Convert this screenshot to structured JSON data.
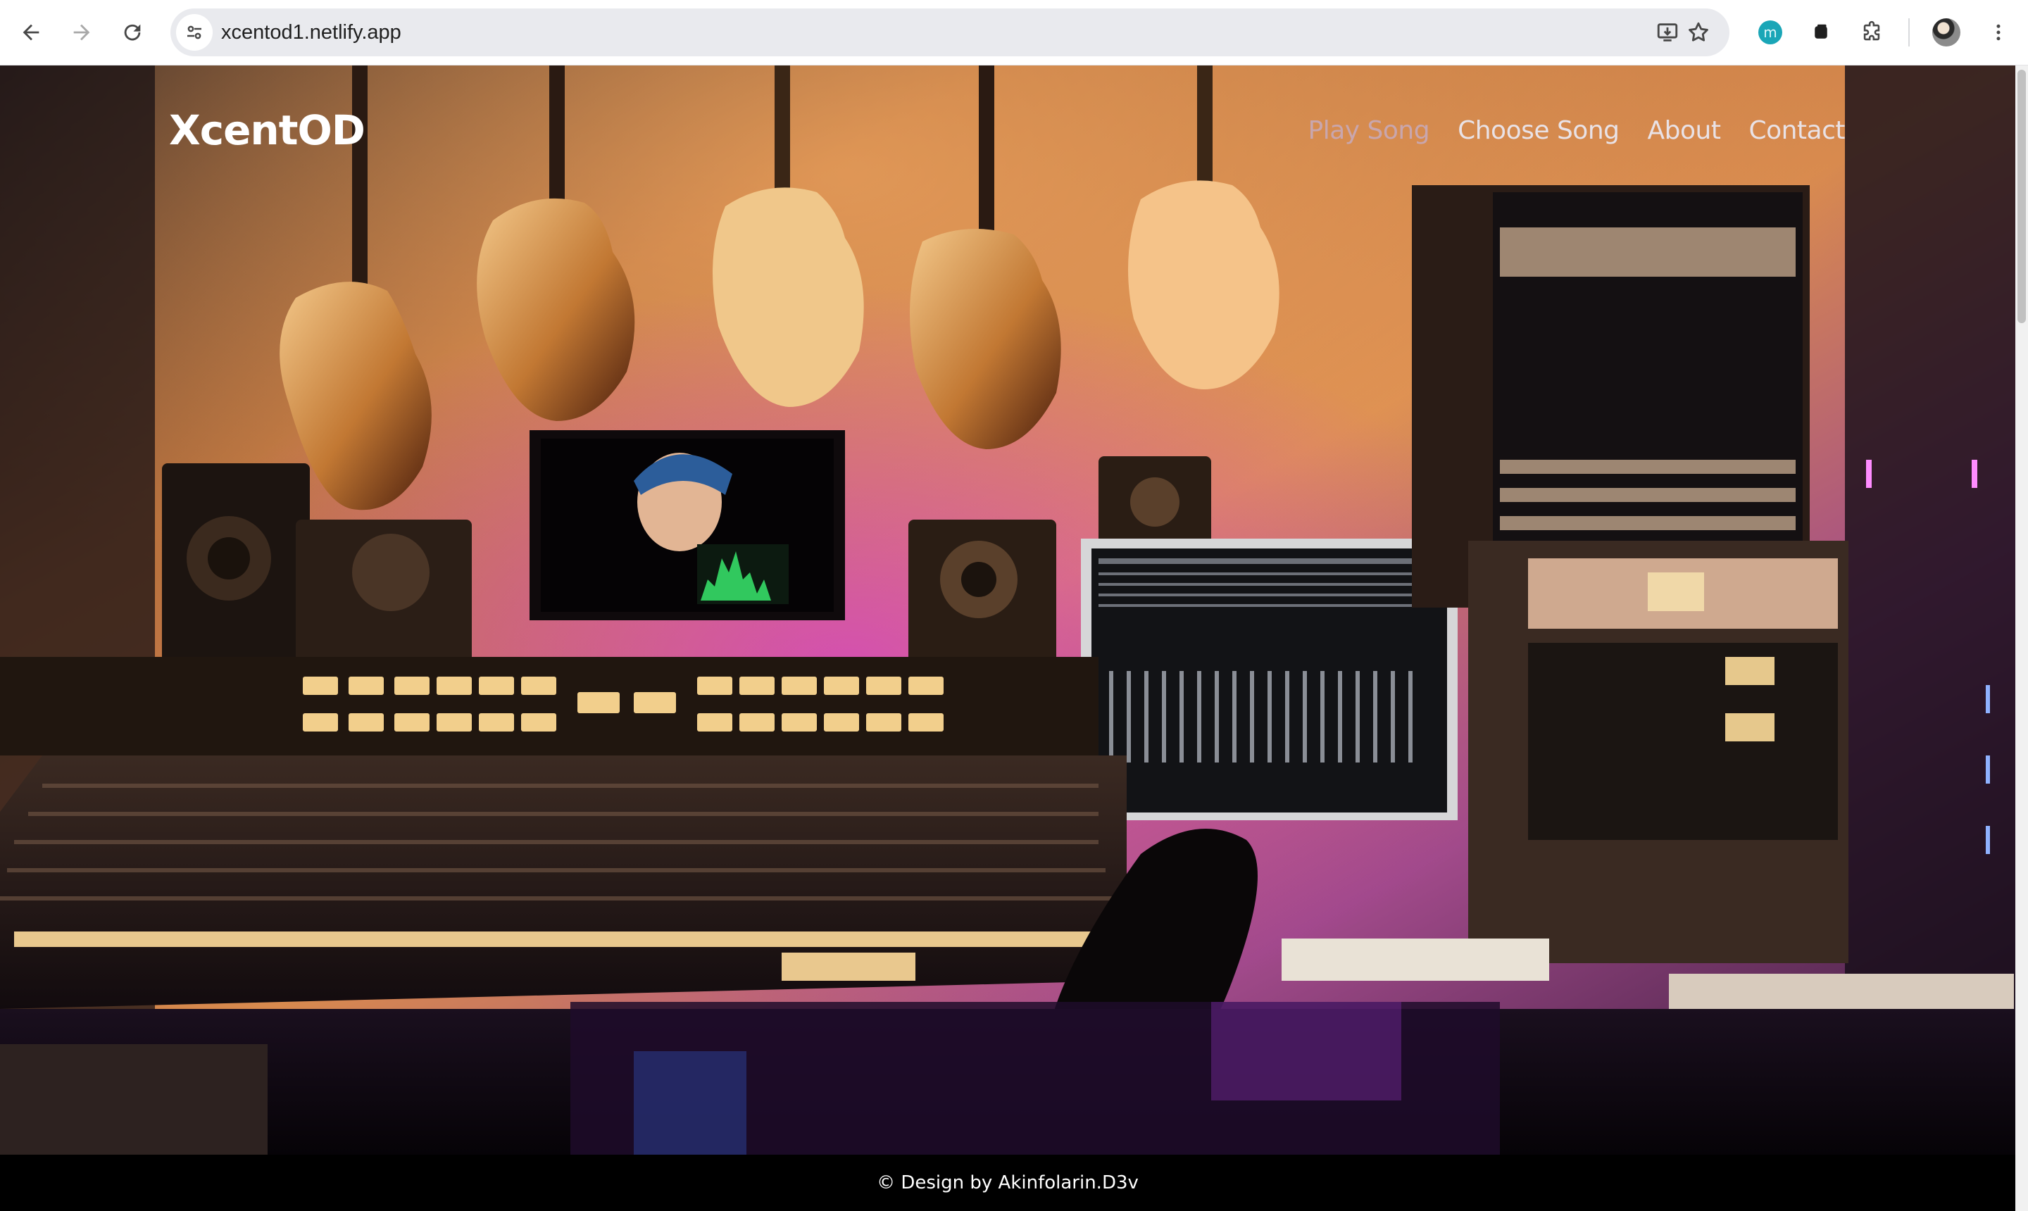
{
  "browser": {
    "url": "xcentod1.netlify.app",
    "extension_badge": "m",
    "icons": {
      "back": "arrow-left-icon",
      "forward": "arrow-right-icon",
      "reload": "reload-icon",
      "site_info": "tune-icon",
      "install": "install-app-icon",
      "bookmark": "star-icon",
      "extensions": "puzzle-icon",
      "menu": "kebab-menu-icon"
    }
  },
  "site": {
    "brand": "XcentOD",
    "nav": [
      {
        "label": "Play Song",
        "active": true
      },
      {
        "label": "Choose Song",
        "active": false
      },
      {
        "label": "About",
        "active": false
      },
      {
        "label": "Contact",
        "active": false
      }
    ],
    "footer": "© Design by Akinfolarin.D3v"
  },
  "colors": {
    "nav_active": "#c9a6ad",
    "nav_default": "#e9e2e6",
    "footer_bg": "#000000"
  }
}
